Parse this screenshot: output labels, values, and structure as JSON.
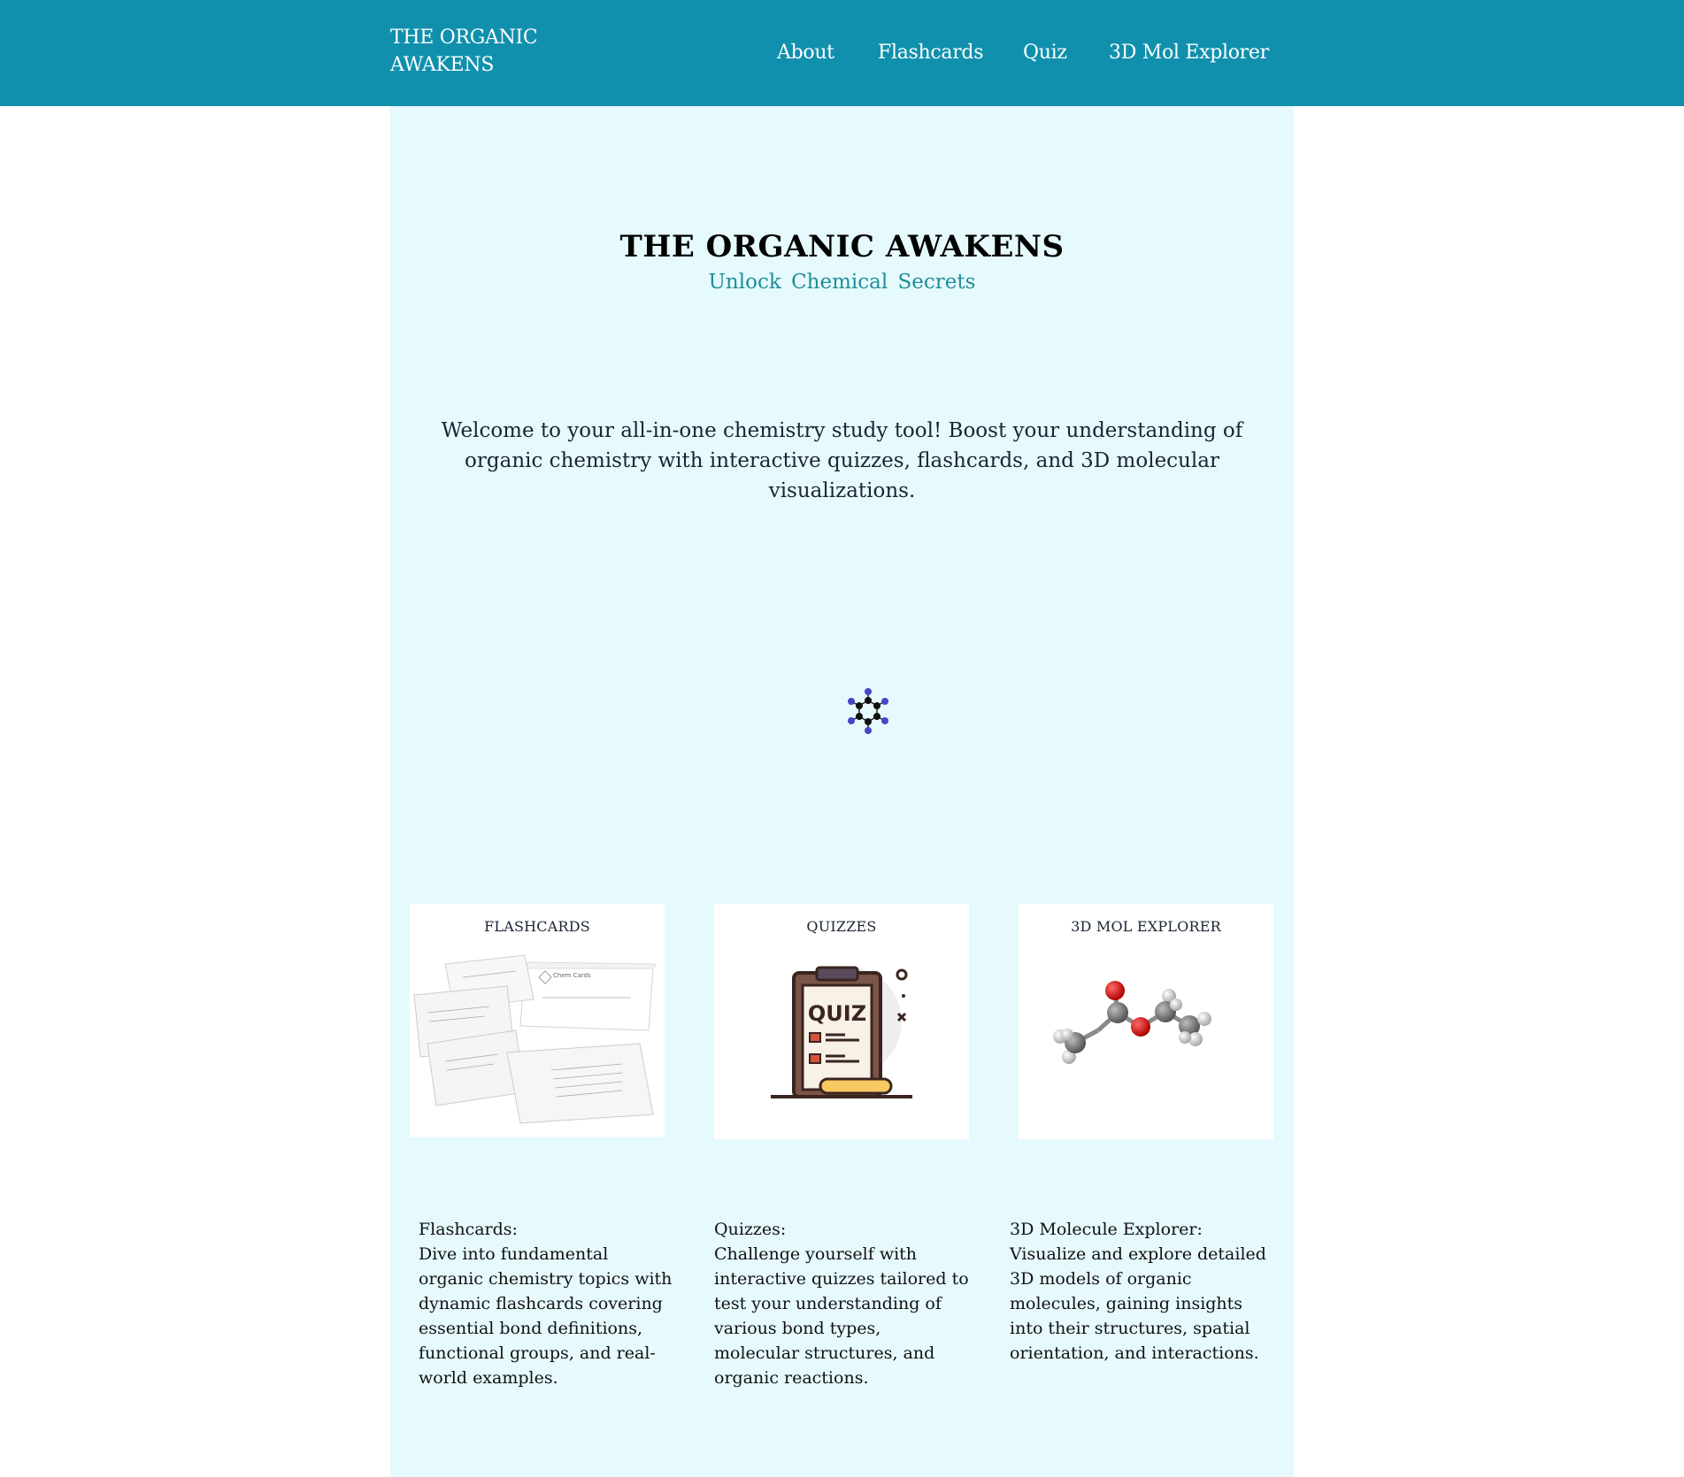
{
  "nav": {
    "brand": "THE ORGANIC AWAKENS",
    "links": [
      "About",
      "Flashcards",
      "Quiz",
      "3D Mol Explorer"
    ]
  },
  "hero": {
    "title": "THE ORGANIC AWAKENS",
    "subtitle": "Unlock Chemical Secrets",
    "welcome": "Welcome to your all-in-one chemistry study tool! Boost your understanding of organic chemistry with interactive quizzes, flashcards, and 3D molecular visualizations."
  },
  "cards": [
    {
      "title": "FLASHCARDS",
      "image_label": "Chem Cards"
    },
    {
      "title": "QUIZZES",
      "image_label": "QUIZ"
    },
    {
      "title": "3D MOL EXPLORER"
    }
  ],
  "descriptions": [
    {
      "heading": "Flashcards:",
      "text": "Dive into fundamental organic chemistry topics with dynamic flashcards covering essential bond definitions, functional groups, and real-world examples."
    },
    {
      "heading": "Quizzes:",
      "text": "Challenge yourself with interactive quizzes tailored to test your understanding of various bond types, molecular structures, and organic reactions."
    },
    {
      "heading": "3D Molecule Explorer:",
      "text": "Visualize and explore detailed 3D models of organic molecules, gaining insights into their structures, spatial orientation, and interactions."
    }
  ],
  "colors": {
    "navbar": "#1190ad",
    "panel": "#e6fafd",
    "subtitle": "#1f8d9a"
  }
}
